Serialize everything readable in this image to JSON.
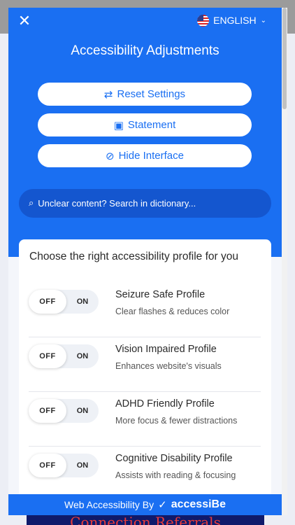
{
  "header": {
    "close_icon": "close-icon",
    "language": "ENGLISH",
    "title": "Accessibility Adjustments"
  },
  "actions": {
    "reset": "Reset Settings",
    "statement": "Statement",
    "hide": "Hide Interface"
  },
  "search": {
    "placeholder": "Unclear content? Search in dictionary..."
  },
  "profiles": {
    "heading": "Choose the right accessibility profile for you",
    "toggle_off": "OFF",
    "toggle_on": "ON",
    "items": [
      {
        "name": "Seizure Safe Profile",
        "desc": "Clear flashes & reduces color"
      },
      {
        "name": "Vision Impaired Profile",
        "desc": "Enhances website's visuals"
      },
      {
        "name": "ADHD Friendly Profile",
        "desc": "More focus & fewer distractions"
      },
      {
        "name": "Cognitive Disability Profile",
        "desc": "Assists with reading & focusing"
      }
    ]
  },
  "footer": {
    "prefix": "Web Accessibility By",
    "brand": "accessiBe"
  },
  "background_page": {
    "footer_text": "Connection Referrals"
  },
  "colors": {
    "accent": "#1a6ff2",
    "search_bg": "#1456cf"
  }
}
